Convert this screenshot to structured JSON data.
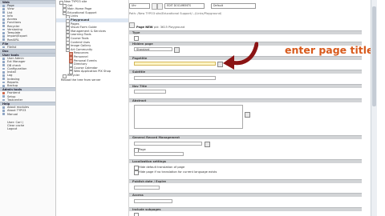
{
  "nav": {
    "sections": [
      {
        "title": "Web",
        "items": [
          {
            "label": "Page",
            "active": true
          },
          {
            "label": "View"
          },
          {
            "label": "List"
          },
          {
            "label": "Info"
          },
          {
            "label": "Access"
          },
          {
            "label": "Functions"
          },
          {
            "label": "Recycler"
          },
          {
            "label": "Versioning"
          },
          {
            "label": "Template"
          },
          {
            "label": "Import/Export"
          },
          {
            "label": "RealURL"
          }
        ]
      },
      {
        "title": "File",
        "items": [
          {
            "label": "Filelist"
          }
        ]
      },
      {
        "title": "Doc",
        "items": []
      },
      {
        "title": "User tools",
        "items": [
          {
            "label": "User Admin"
          },
          {
            "label": "Ext Manager"
          },
          {
            "label": "DB check"
          },
          {
            "label": "Configuration"
          },
          {
            "label": "Install"
          },
          {
            "label": "Log"
          },
          {
            "label": "Indexing"
          },
          {
            "label": "Reports"
          },
          {
            "label": "Backup"
          }
        ]
      },
      {
        "title": "Admin tools",
        "items": [
          {
            "label": "Frontend",
            "red": true
          },
          {
            "label": "Setup"
          },
          {
            "label": "Taskcenter"
          }
        ]
      },
      {
        "title": "Help",
        "items": [
          {
            "label": "About modules"
          },
          {
            "label": "About TYPO3"
          },
          {
            "label": "Manual"
          }
        ]
      }
    ],
    "footer": [
      "User: Carl (",
      "Clear cache",
      "Logout"
    ]
  },
  "tree": {
    "items": [
      {
        "label": "New TYPO3 site",
        "indent": 0
      },
      {
        "label": "Get",
        "indent": 1
      },
      {
        "label": "Main Home Page",
        "indent": 1
      },
      {
        "label": "Educational Support",
        "indent": 1
      },
      {
        "label": "Links",
        "indent": 2
      },
      {
        "label": "Playground",
        "indent": 2,
        "bold": true,
        "sel": true
      },
      {
        "label": "Pages",
        "indent": 2
      },
      {
        "label": "Visual Form Guide",
        "indent": 2
      },
      {
        "label": "Management & Services",
        "indent": 2
      },
      {
        "label": "Learning Tools",
        "indent": 2
      },
      {
        "label": "Course Tools",
        "indent": 2
      },
      {
        "label": "Content Uses",
        "indent": 2
      },
      {
        "label": "Image Gallery",
        "indent": 2
      },
      {
        "label": "Art Community",
        "indent": 2
      },
      {
        "label": "Resources",
        "indent": 3,
        "red": true
      },
      {
        "label": "Personnel",
        "indent": 3,
        "red": true
      },
      {
        "label": "Personal Events",
        "indent": 3,
        "red": true
      },
      {
        "label": "Directory",
        "indent": 3
      },
      {
        "label": "Course Calendar",
        "indent": 3
      },
      {
        "label": "Web Application PIX Shop",
        "indent": 3
      },
      {
        "label": "Recycler",
        "indent": 1
      }
    ],
    "footer": "Reload the tree from server"
  },
  "topbar": {
    "select_value": "Uhr",
    "mode_value": "EDIT DOCUMENTS",
    "lang_value": "Default"
  },
  "path": "Path: /New TYPO3 site/Educational Support/.../Links/Playground/",
  "page": {
    "title_prefix": "Page NEW",
    "title_rest": "pid: 3615 Playground"
  },
  "sections": {
    "type": "Type",
    "hidden_page": "Hidden page",
    "pagetitle": "Pagetitle",
    "subtitle": "Subtitle",
    "nav_title": "Nav Title",
    "abstract": "Abstract",
    "general_options": "General Record Management",
    "language": "Localization settings",
    "hide_default": "Hide default translation of page",
    "hide_no_translation": "Hide page if no translation for current language exists",
    "publish_date": "Publish date / Expire",
    "access": "Access",
    "include_subpages": "Include subpages"
  },
  "fields": {
    "type_value": "Standard",
    "pagetitle_value": "",
    "subtitle_value": "",
    "page_chk_label": "Page"
  },
  "annotation": "enter page title",
  "colors": {
    "annotation": "#d85a1c",
    "arrow": "#8b1414",
    "section_bg": "#d2d4d6"
  }
}
